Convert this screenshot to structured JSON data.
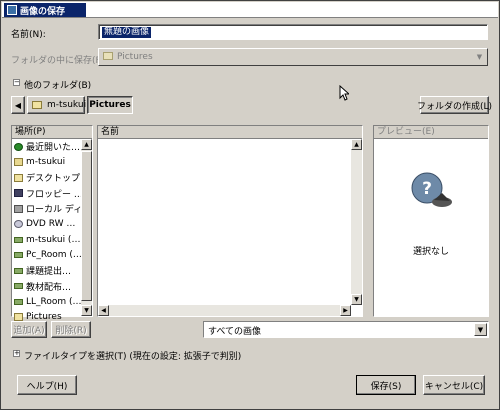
{
  "window": {
    "title": "画像の保存"
  },
  "name_field": {
    "label": "名前(N):",
    "value": "無題の画像"
  },
  "folder_field": {
    "label": "フォルダの中に保存(F):",
    "value": "Pictures"
  },
  "browse": {
    "expander_label": "他のフォルダ(B)",
    "create_folder": "フォルダの作成(L)"
  },
  "pathbar": {
    "back_arrow": "◀",
    "segments": [
      "m-tsukui",
      "Pictures"
    ]
  },
  "places": {
    "header": "場所(P)",
    "items": [
      {
        "label": "最近開いた…",
        "icon": "recent-icon"
      },
      {
        "label": "m-tsukui",
        "icon": "home-folder-icon"
      },
      {
        "label": "デスクトップ",
        "icon": "desktop-folder-icon"
      },
      {
        "label": "フロッピー …",
        "icon": "floppy-icon"
      },
      {
        "label": "ローカル ディ…",
        "icon": "hard-drive-icon"
      },
      {
        "label": "DVD RW …",
        "icon": "dvd-drive-icon"
      },
      {
        "label": "m-tsukui (…",
        "icon": "network-drive-icon"
      },
      {
        "label": "Pc_Room (…",
        "icon": "network-drive-icon"
      },
      {
        "label": "課題提出…",
        "icon": "network-drive-icon"
      },
      {
        "label": "教材配布…",
        "icon": "network-drive-icon"
      },
      {
        "label": "LL_Room (…",
        "icon": "network-drive-icon"
      },
      {
        "label": "Pictures",
        "icon": "folder-icon"
      }
    ],
    "add_button": "追加(A)",
    "remove_button": "削除(R)"
  },
  "files": {
    "header": "名前"
  },
  "preview": {
    "header": "プレビュー(E)",
    "empty_text": "選択なし"
  },
  "filter": {
    "value": "すべての画像"
  },
  "filetype": {
    "label": "ファイルタイプを選択(T)  (現在の設定: 拡張子で判別)"
  },
  "buttons": {
    "help": "ヘルプ(H)",
    "save": "保存(S)",
    "cancel": "キャンセル(C)"
  },
  "colors": {
    "title_active": "#0a246a",
    "dialog_face": "#d4d0c8",
    "selection": "#0a246a"
  }
}
